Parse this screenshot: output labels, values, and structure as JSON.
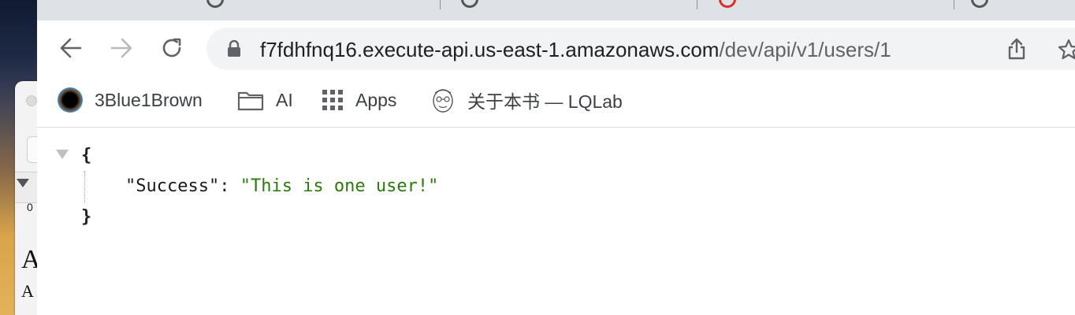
{
  "tabs": [
    {
      "title": ""
    },
    {
      "title": ""
    },
    {
      "title": ""
    },
    {
      "title": ""
    }
  ],
  "toolbar": {
    "url_host": "f7fdhfnq16.execute-api.us-east-1.amazonaws.com",
    "url_path": "/dev/api/v1/users/1"
  },
  "bookmarks": [
    {
      "label": "3Blue1Brown",
      "icon": "3blue1brown-icon"
    },
    {
      "label": "AI",
      "icon": "folder-icon"
    },
    {
      "label": "Apps",
      "icon": "apps-grid-icon"
    },
    {
      "label": "关于本书 — LQLab",
      "icon": "avatar-sketch-icon"
    }
  ],
  "json_view": {
    "open_brace": "{",
    "key": "\"Success\"",
    "colon": ": ",
    "value": "\"This is one user!\"",
    "close_brace": "}"
  },
  "background_window": {
    "number": "0",
    "big_letter": "A",
    "small_letter": "A"
  },
  "colors": {
    "string_value": "#2b7a0b",
    "tabstrip": "#dee1e6",
    "omnibox": "#f1f3f4"
  }
}
